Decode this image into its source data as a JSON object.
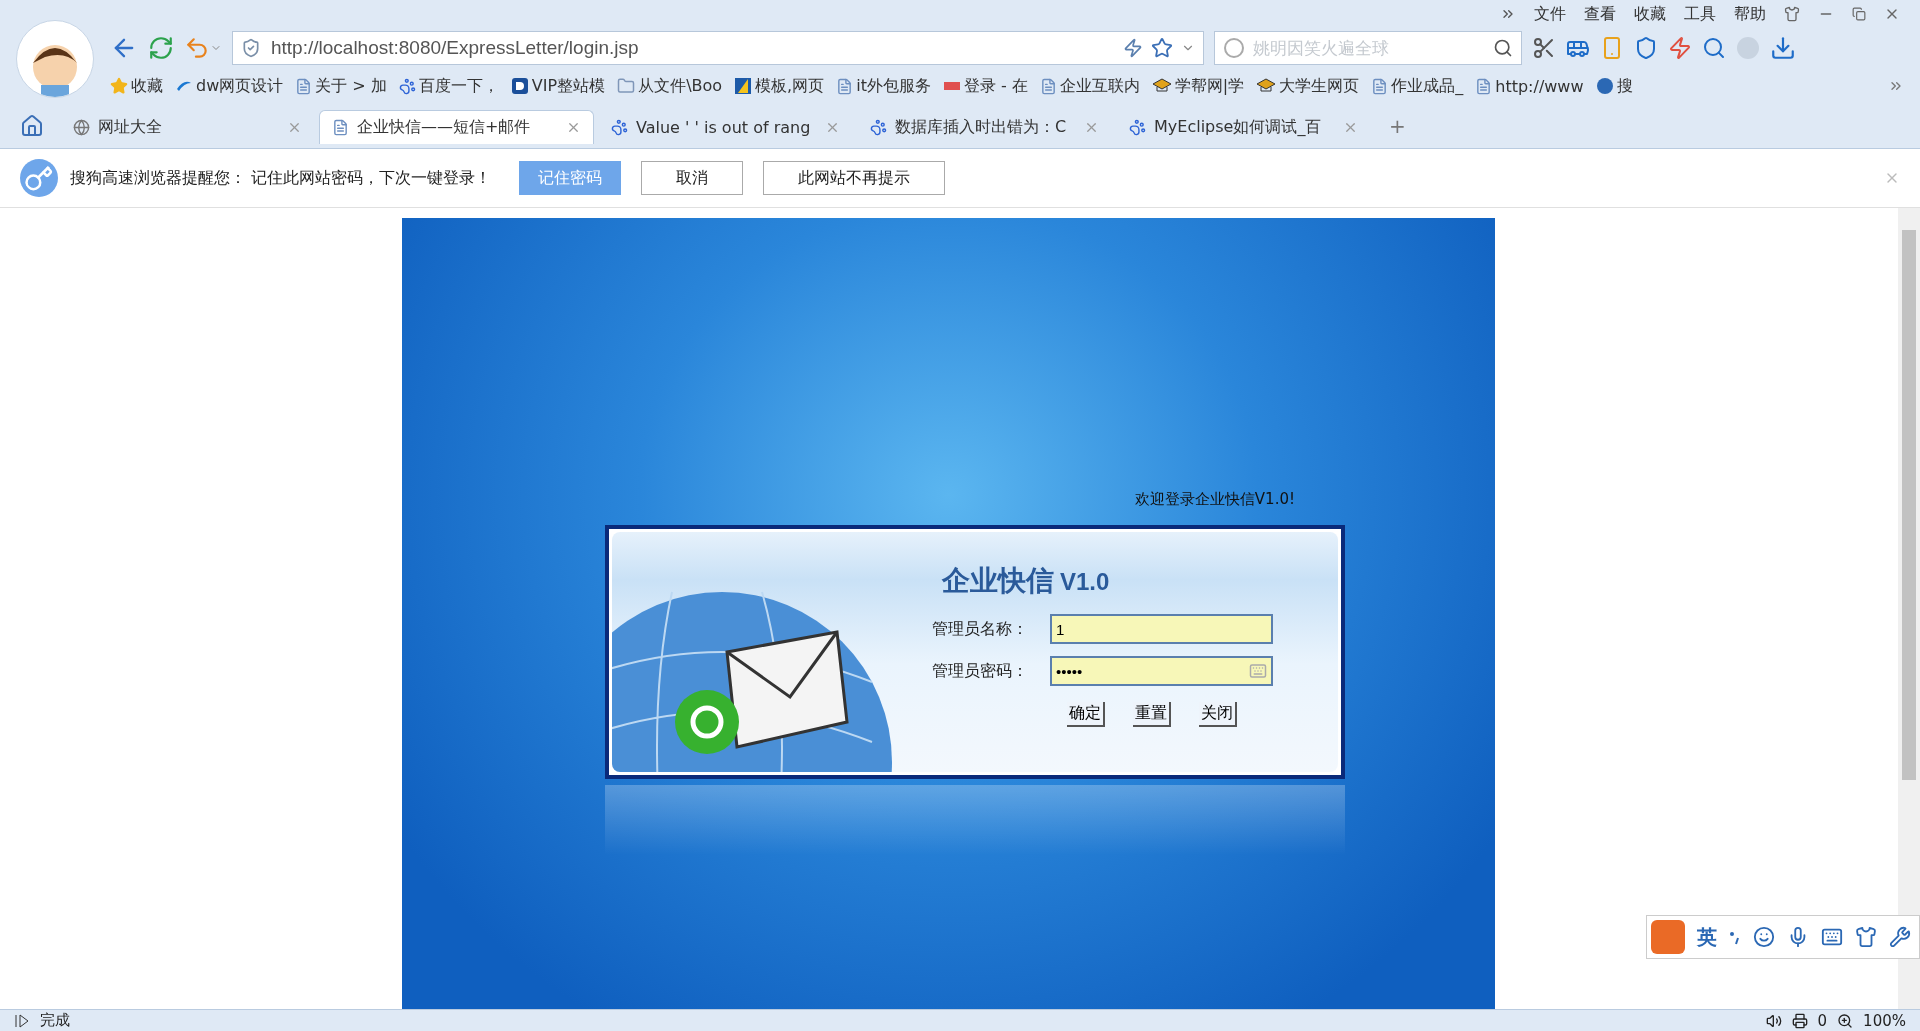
{
  "menu": [
    "文件",
    "查看",
    "收藏",
    "工具",
    "帮助"
  ],
  "address": {
    "value": "http://localhost:8080/ExpressLetter/login.jsp"
  },
  "search": {
    "placeholder": "姚明因笑火遍全球"
  },
  "bookmarks": [
    {
      "label": "收藏",
      "kind": "star"
    },
    {
      "label": "dw网页设计",
      "kind": "swirl"
    },
    {
      "label": "关于 > 加",
      "kind": "page"
    },
    {
      "label": "百度一下，",
      "kind": "paw"
    },
    {
      "label": "VIP整站模",
      "kind": "badge"
    },
    {
      "label": "从文件\\Boo",
      "kind": "folder"
    },
    {
      "label": "模板,网页",
      "kind": "tile"
    },
    {
      "label": "it外包服务",
      "kind": "page"
    },
    {
      "label": "登录 - 在",
      "kind": "tag"
    },
    {
      "label": "企业互联内",
      "kind": "page"
    },
    {
      "label": "学帮网|学",
      "kind": "hat"
    },
    {
      "label": "大学生网页",
      "kind": "hat"
    },
    {
      "label": "作业成品_",
      "kind": "page"
    },
    {
      "label": "http://www",
      "kind": "page"
    },
    {
      "label": "搜",
      "kind": "circle"
    }
  ],
  "tabs": [
    {
      "label": "网址大全",
      "kind": "globe",
      "selected": false
    },
    {
      "label": "企业快信——短信+邮件",
      "kind": "page",
      "selected": true
    },
    {
      "label": "Value ' ' is out of rang",
      "kind": "paw",
      "selected": false
    },
    {
      "label": "数据库插入时出错为：C",
      "kind": "paw",
      "selected": false
    },
    {
      "label": "MyEclipse如何调试_百",
      "kind": "paw",
      "selected": false
    }
  ],
  "new_tab": "+",
  "notice": {
    "message": "搜狗高速浏览器提醒您： 记住此网站密码，下次一键登录！",
    "buttons": [
      {
        "label": "记住密码",
        "primary": true
      },
      {
        "label": "取消",
        "primary": false
      },
      {
        "label": "此网站不再提示",
        "primary": false
      }
    ]
  },
  "login": {
    "welcome": "欢迎登录企业快信V1.0!",
    "title": "企业快信",
    "version": "V1.0",
    "fields": [
      {
        "label": "管理员名称：",
        "value": "1",
        "kind": "text"
      },
      {
        "label": "管理员密码：",
        "value": "•••••",
        "kind": "password"
      }
    ],
    "buttons": [
      "确定",
      "重置",
      "关闭"
    ]
  },
  "status": {
    "text": "完成",
    "count": "0",
    "zoom": "100%"
  },
  "ime": {
    "mode": "英"
  }
}
